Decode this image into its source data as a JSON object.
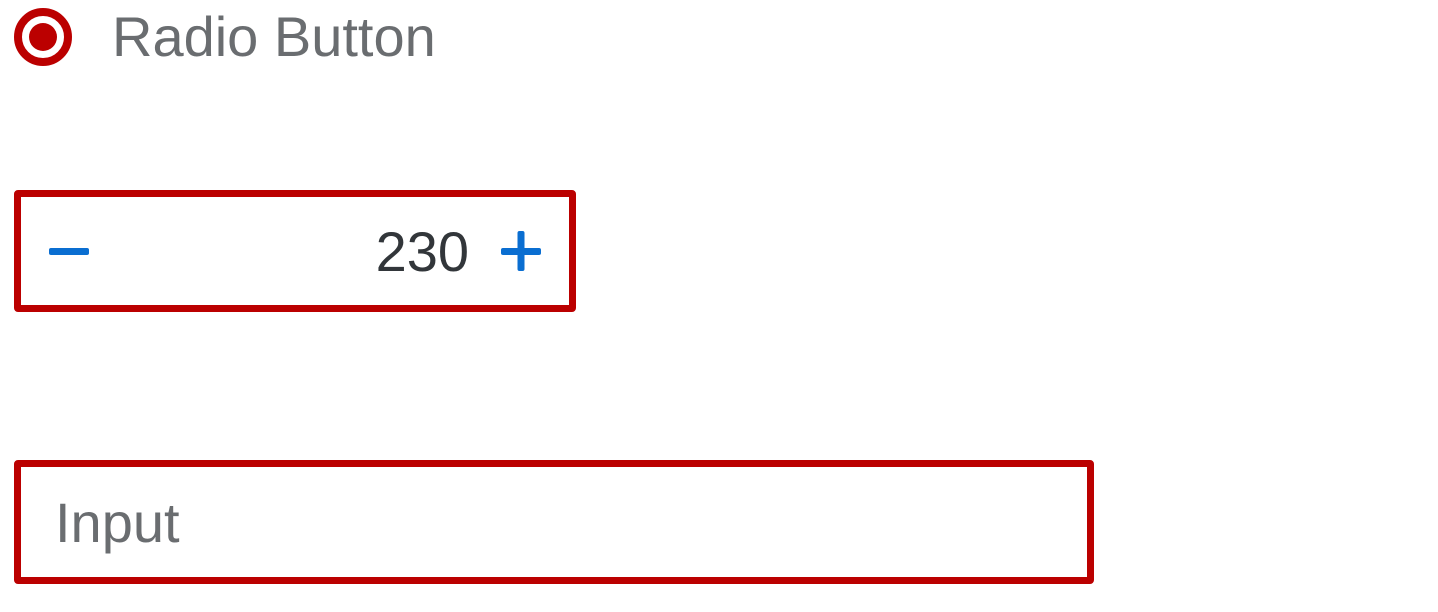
{
  "radio": {
    "label": "Radio Button",
    "selected": true,
    "state": "error"
  },
  "stepInput": {
    "value": "230",
    "state": "error",
    "decrement_icon": "minus-icon",
    "increment_icon": "plus-icon"
  },
  "textInput": {
    "placeholder": "Input",
    "value": "",
    "state": "error"
  },
  "colors": {
    "error": "#bb0000",
    "iconBlue": "#0a6ed1",
    "textGrey": "#6a6d70",
    "textDark": "#32363a"
  }
}
